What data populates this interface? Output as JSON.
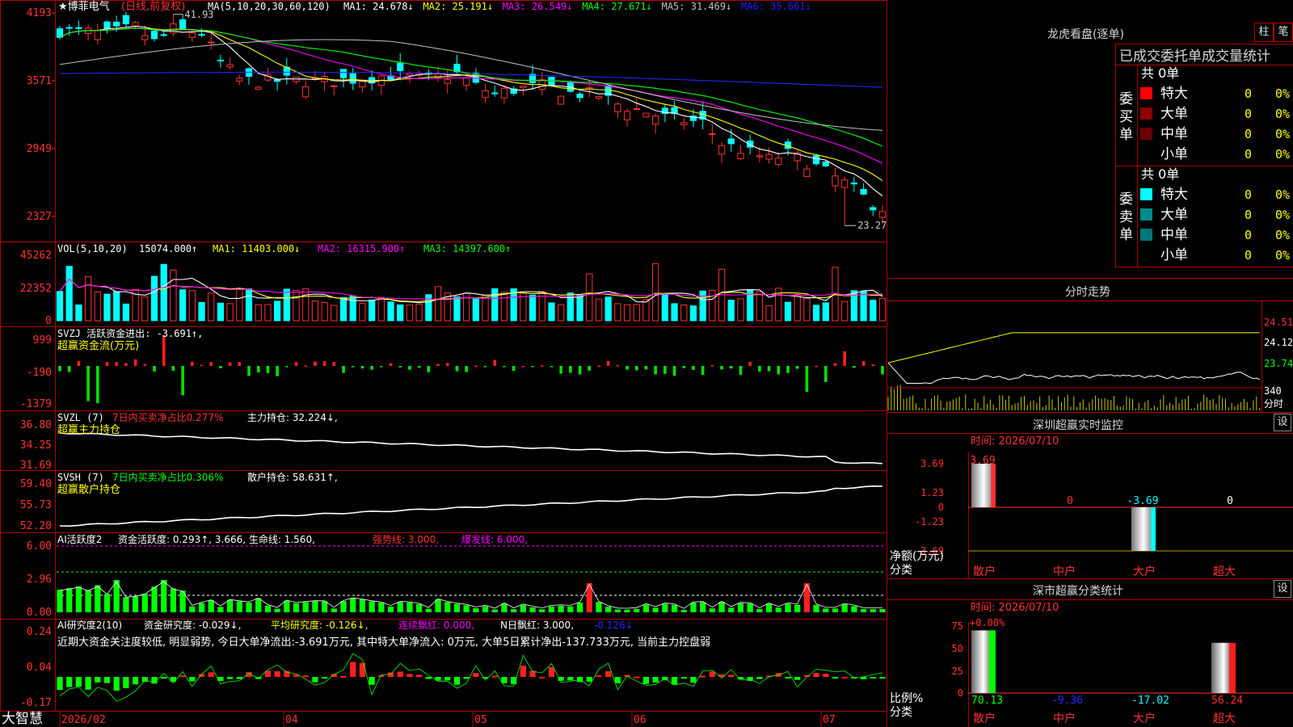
{
  "app": {
    "brand": "大智慧",
    "star": "★"
  },
  "kline": {
    "stock_name": "博菲电气",
    "mode": "(日线,前复权)",
    "ma_header": "MA(5,10,20,30,60,120)",
    "ma_values": [
      {
        "label": "MA1: 24.678↓",
        "color": "#ffffff"
      },
      {
        "label": "MA2: 25.191↓",
        "color": "#ffff00"
      },
      {
        "label": "MA3: 26.549↓",
        "color": "#ff00ff"
      },
      {
        "label": "MA4: 27.671↓",
        "color": "#00ff00"
      },
      {
        "label": "MA5: 31.469↓",
        "color": "#c0c0c0"
      },
      {
        "label": "MA6: 35.661↓",
        "color": "#2020ff"
      }
    ],
    "y_ticks": [
      "4193",
      "3571",
      "2949",
      "2327"
    ],
    "high_mark": "41.93",
    "low_mark": "23.27"
  },
  "vol": {
    "header": "VOL(5,10,20)",
    "value": "15074.000↑",
    "ma1": "MA1: 11403.000↓",
    "ma2": "MA2: 16315.900↑",
    "ma3": "MA3: 14397.600↑",
    "y_ticks": [
      "45262",
      "22352",
      "0"
    ]
  },
  "svzj": {
    "header": "SVZJ  活跃资金进出: -3.691↑,",
    "subtitle": "超赢资金流(万元)",
    "y_ticks": [
      "999",
      "-190",
      "-1379"
    ]
  },
  "svzl": {
    "header": "SVZL (7)",
    "net": "7日内买卖净占比0.277%",
    "hold": "主力持仓: 32.224↓,",
    "subtitle": "超赢主力持仓",
    "y_ticks": [
      "36.80",
      "34.25",
      "31.69"
    ]
  },
  "svsh": {
    "header": "SVSH (7)",
    "net": "7日内买卖净占比0.306%",
    "hold": "散户持仓: 58.631↑,",
    "subtitle": "超赢散户持仓",
    "y_ticks": [
      "59.40",
      "55.73",
      "52.20"
    ]
  },
  "ai_active": {
    "header": "AI活跃度2",
    "value": "资金活跃度: 0.293↑, 3.666, 生命线: 1.560,",
    "strong": "强势线: 3.000,",
    "burst": "爆发线: 6.000,",
    "y_ticks": [
      "6.00",
      "2.96",
      "0.00"
    ]
  },
  "ai_research": {
    "header": "AI研究度2(10)",
    "value": "资金研究度: -0.029↓,",
    "avg": "平均研究度: -0.126↓,",
    "cont": "连续飘红: 0.000,",
    "nday": "N日飘红: 3.000,",
    "last": "-0.126↓",
    "comment": "近期大资金关注度较低, 明显弱势, 今日大单净流出:-3.691万元, 其中特大单净流入: 0万元, 大单5日累计净出-137.733万元, 当前主力控盘弱",
    "y_ticks": [
      "0.24",
      "0.04",
      "-0.17"
    ]
  },
  "x_axis": {
    "labels": [
      "2026/02",
      "04",
      "05",
      "06",
      "07"
    ]
  },
  "dragon": {
    "title": "龙虎看盘(逐单)",
    "btn1": "柱",
    "btn2": "笔",
    "tabs": "已成交委托单成交量统计",
    "buy_label": "委买单",
    "sell_label": "委卖单",
    "buy_total": "共 0单",
    "sell_total": "共 0单",
    "buy_rows": [
      {
        "name": "特大",
        "count": "0",
        "pct": "0%",
        "color": "#ff0000"
      },
      {
        "name": "大单",
        "count": "0",
        "pct": "0%",
        "color": "#8b0000"
      },
      {
        "name": "中单",
        "count": "0",
        "pct": "0%",
        "color": "#6b0000"
      },
      {
        "name": "小单",
        "count": "0",
        "pct": "0%",
        "color": ""
      }
    ],
    "sell_rows": [
      {
        "name": "特大",
        "count": "0",
        "pct": "0%",
        "color": "#00ffff"
      },
      {
        "name": "大单",
        "count": "0",
        "pct": "0%",
        "color": "#008b8b"
      },
      {
        "name": "中单",
        "count": "0",
        "pct": "0%",
        "color": "#007777"
      },
      {
        "name": "小单",
        "count": "0",
        "pct": "0%",
        "color": ""
      }
    ]
  },
  "intraday": {
    "title": "分时走势",
    "prices": [
      "24.51",
      "24.12",
      "23.74"
    ],
    "vol": "340",
    "unit": "分时"
  },
  "monitor": {
    "title": "深圳超赢实时监控",
    "set": "设",
    "time": "时间: 2026/07/10",
    "y_ticks": [
      "3.69",
      "1.23",
      "0",
      "-1.23",
      "-3.69"
    ],
    "unit": "净额(万元)",
    "cat": "分类",
    "categories": [
      "散户",
      "中户",
      "大户",
      "超大"
    ],
    "values": [
      3.69,
      0,
      -3.69,
      0
    ],
    "value_labels": [
      "3.69",
      "0",
      "-3.69",
      "0"
    ]
  },
  "classify": {
    "title": "深市超赢分类统计",
    "set": "设",
    "time": "时间: 2026/07/10",
    "top_label": "+0.00%",
    "y_ticks": [
      "75",
      "50",
      "25",
      "0"
    ],
    "unit": "比例%",
    "cat": "分类",
    "categories": [
      "散户",
      "中户",
      "大户",
      "超大"
    ],
    "values": [
      70.13,
      -9.36,
      -17.02,
      56.24
    ],
    "value_labels": [
      "70.13",
      "-9.36",
      "-17.02",
      "56.24"
    ]
  },
  "colors": {
    "up": "#ff3232",
    "down": "#00ffff",
    "grid": "#b00000",
    "text": "#c0c0c0"
  }
}
